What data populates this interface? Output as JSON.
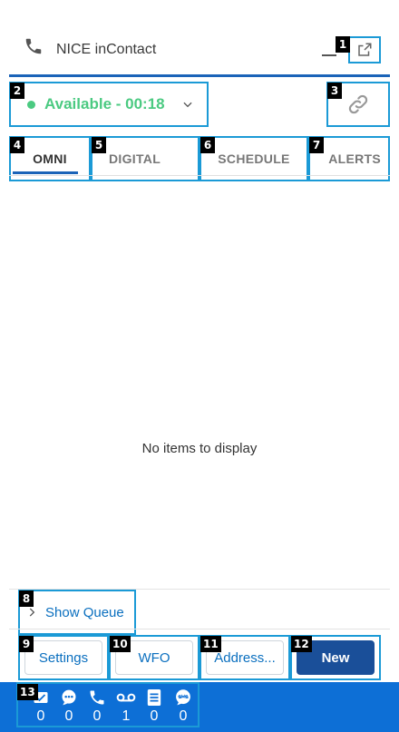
{
  "header": {
    "title": "NICE inContact"
  },
  "status": {
    "label": "Available - 00:18",
    "color": "#4bca81"
  },
  "tabs": [
    {
      "label": "OMNI",
      "active": true
    },
    {
      "label": "DIGITAL",
      "active": false
    },
    {
      "label": "SCHEDULE",
      "active": false
    },
    {
      "label": "ALERTS",
      "active": false
    }
  ],
  "main": {
    "empty_text": "No items to display"
  },
  "queue": {
    "label": "Show Queue"
  },
  "buttons": {
    "settings": "Settings",
    "wfo": "WFO",
    "address": "Address...",
    "new": "New"
  },
  "counters": [
    {
      "icon": "email-icon",
      "value": "0"
    },
    {
      "icon": "chat-icon",
      "value": "0"
    },
    {
      "icon": "phone-icon",
      "value": "0"
    },
    {
      "icon": "voicemail-icon",
      "value": "1"
    },
    {
      "icon": "work-item-icon",
      "value": "0"
    },
    {
      "icon": "sms-icon",
      "value": "0"
    }
  ],
  "badges": [
    "1",
    "2",
    "3",
    "4",
    "5",
    "6",
    "7",
    "8",
    "9",
    "10",
    "11",
    "12",
    "13"
  ],
  "colors": {
    "accent": "#1a63b8",
    "footer": "#0d6fd6",
    "primary_button": "#1a4f99",
    "link": "#0a6fbf",
    "highlight_box": "#1b9ad6"
  }
}
